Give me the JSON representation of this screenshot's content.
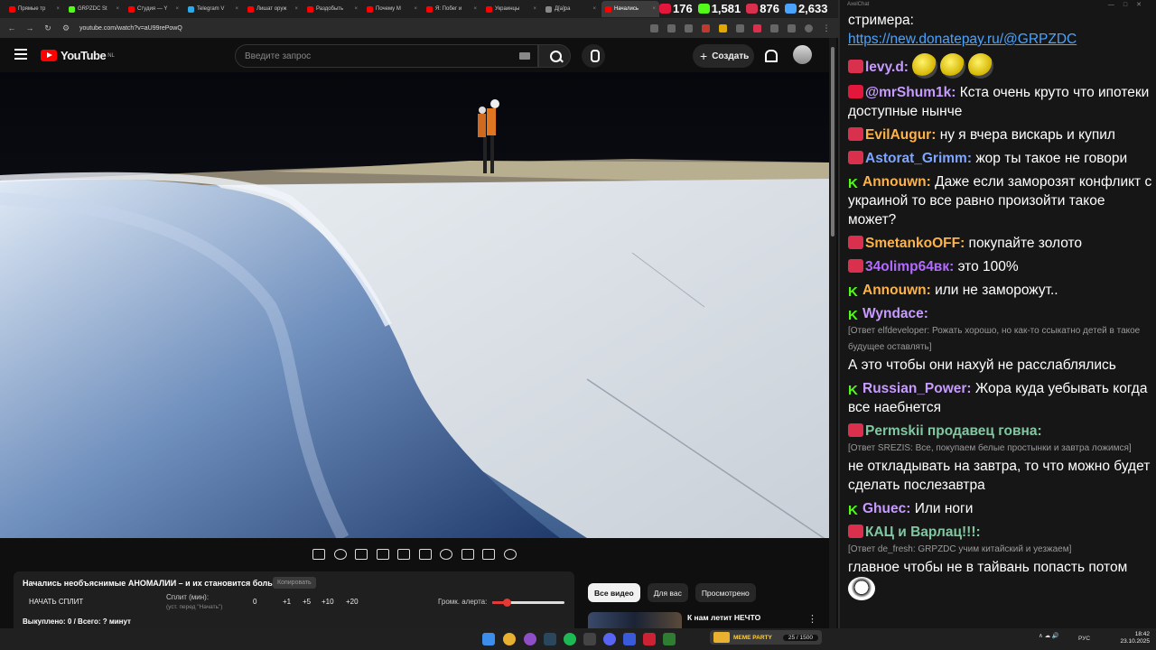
{
  "browser": {
    "tabs": [
      {
        "label": "Прямые тр",
        "favicon": "#ff0000"
      },
      {
        "label": "GRPZDC St",
        "favicon": "#53fc18"
      },
      {
        "label": "Студия — Y",
        "favicon": "#ff0000"
      },
      {
        "label": "Telegram V",
        "favicon": "#2aabee"
      },
      {
        "label": "Лишат оруж",
        "favicon": "#ff0000"
      },
      {
        "label": "Раздобыть",
        "favicon": "#ff0000"
      },
      {
        "label": "Почему М",
        "favicon": "#ff0000"
      },
      {
        "label": "Я: Побег и",
        "favicon": "#ff0000"
      },
      {
        "label": "Украинцы",
        "favicon": "#ff0000"
      },
      {
        "label": "Д[а]ра",
        "favicon": "#888888"
      },
      {
        "label": "Начались",
        "favicon": "#ff0000"
      }
    ],
    "url": "youtube.com/watch?v=aU99rePowQ"
  },
  "stats": [
    {
      "value": "176",
      "color": "#e3163b"
    },
    {
      "value": "1,581",
      "color": "#53fc18"
    },
    {
      "value": "876",
      "color": "#d8304d"
    },
    {
      "value": "2,633",
      "color": "#4aa3ff"
    }
  ],
  "youtube": {
    "logo_text": "YouTube",
    "region": "NL",
    "search_placeholder": "Введите запрос",
    "create_label": "Создать"
  },
  "alerts_panel": {
    "title": "Начались необъяснимые АНОМАЛИИ – и их становится больше.",
    "copy_label": "Копировать",
    "start_split": "НАЧАТЬ СПЛИТ",
    "split_label": "Сплит (мин):",
    "split_hint": "(уст. перед \"Начать\")",
    "split_value": "0",
    "increments": [
      "+1",
      "+5",
      "+10",
      "+20"
    ],
    "volume_label": "Громк. алерта:",
    "volume_level": 0.2,
    "status": "Выкуплено: 0 / Всего: ? минут"
  },
  "filters": [
    "Все видео",
    "Для вас",
    "Просмотрено"
  ],
  "recommendation": {
    "title": "К нам летит НЕЧТО"
  },
  "chat": {
    "window_title": "AxelChat",
    "messages": [
      {
        "badge": "",
        "user": "",
        "user_color": "#ffffff",
        "text": "стримера:",
        "link": "https://new.donatepay.ru/@GRPZDC",
        "reply": ""
      },
      {
        "badge": "live",
        "user": "levy.d:",
        "user_color": "#c79bff",
        "text": "",
        "link": "",
        "reply": "",
        "emotes": 3
      },
      {
        "badge": "yt",
        "user": "@mrShum1k:",
        "user_color": "#c79bff",
        "text": "Кста очень круто что ипотеки доступные нынче",
        "link": "",
        "reply": ""
      },
      {
        "badge": "live",
        "user": "EvilAugur:",
        "user_color": "#ffb347",
        "text": "ну я вчера вискарь и купил",
        "link": "",
        "reply": ""
      },
      {
        "badge": "live",
        "user": "Astorat_Grimm:",
        "user_color": "#7ea6ff",
        "text": "жор ты такое не говори",
        "link": "",
        "reply": ""
      },
      {
        "badge": "kick",
        "user": "Annouwn:",
        "user_color": "#ffb347",
        "text": "Даже если заморозят конфликт с украиной то все равно произойти такое может?",
        "link": "",
        "reply": ""
      },
      {
        "badge": "live",
        "user": "SmetankoOFF:",
        "user_color": "#ffb347",
        "text": "покупайте золото",
        "link": "",
        "reply": ""
      },
      {
        "badge": "live",
        "user": "34olimp64вк:",
        "user_color": "#b36bff",
        "text": "это 100%",
        "link": "",
        "reply": ""
      },
      {
        "badge": "kick",
        "user": "Annouwn:",
        "user_color": "#ffb347",
        "text": "или не заморожут..",
        "link": "",
        "reply": ""
      },
      {
        "badge": "kick",
        "user": "Wyndace:",
        "user_color": "#c79bff",
        "text": "А это чтобы они нахуй не расслаблялись",
        "link": "",
        "reply": "[Ответ elfdeveloper: Рожать хорошо, но как-то ссыкатно детей в такое будущее оставлять]"
      },
      {
        "badge": "kick",
        "user": "Russian_Power:",
        "user_color": "#c79bff",
        "text": "Жора куда уебывать когда все наебнется",
        "link": "",
        "reply": ""
      },
      {
        "badge": "live",
        "user": "Permskii продавец говна:",
        "user_color": "#7fc8a0",
        "text": "не откладывать на завтра, то что можно будет сделать послезавтра",
        "link": "",
        "reply": "[Ответ SREZIS: Все, покупаем белые простынки и завтра ложимся]"
      },
      {
        "badge": "kick",
        "user": "Ghuec:",
        "user_color": "#c79bff",
        "text": "Или ноги",
        "link": "",
        "reply": ""
      },
      {
        "badge": "live",
        "user": "КАЦ и Варлац!!!:",
        "user_color": "#7fc8a0",
        "text": "главное чтобы не в тайвань попасть потом",
        "link": "",
        "reply": "[Ответ de_fresh: GRPZDC учим китайский и уезжаем]"
      }
    ]
  },
  "taskbar": {
    "meme_label": "MEME PARTY",
    "meme_count": "25 / 1500",
    "tray_lang": "РУС",
    "time": "18:42",
    "date": "23.10.2025"
  }
}
